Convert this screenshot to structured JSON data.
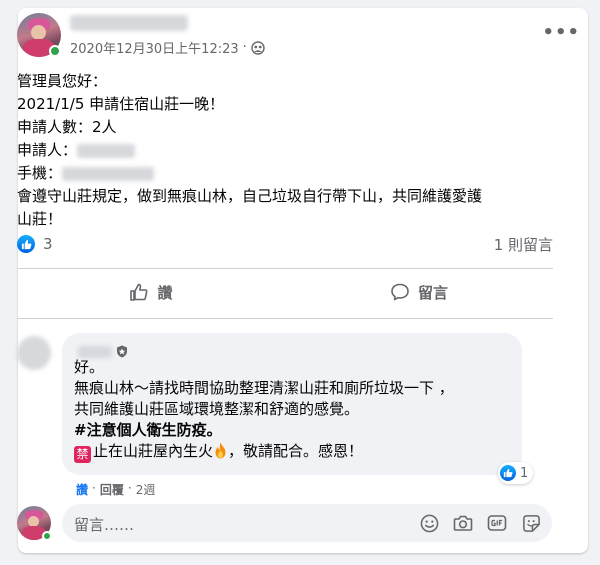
{
  "post": {
    "timestamp": "2020年12月30日上午12:23",
    "separator": "·",
    "more_label": "•••",
    "body": {
      "greeting": "管理員您好：",
      "request": "2021/1/5 申請住宿山莊一晚！",
      "headcount": "申請人數：2人",
      "applicant_label": "申請人：",
      "phone_label": "手機：",
      "pledge_1": "會遵守山莊規定，做到無痕山林，自己垃圾自行帶下山，共同維護愛護",
      "pledge_2": "山莊！"
    }
  },
  "stats": {
    "like_count": "3",
    "comment_count": "1 則留言"
  },
  "actions": {
    "like_label": "讚",
    "comment_label": "留言"
  },
  "comment": {
    "line1": "好。",
    "line2": "無痕山林～請找時間協助整理清潔山莊和廁所垃圾一下 ，",
    "line3": "共同維護山莊區域環境整潔和舒適的感覺。",
    "line4": "#注意個人衛生防疫。",
    "ban_glyph": "禁",
    "line5_text": "止在山莊屋內生火",
    "line5_tail": "，敬請配合。感恩！",
    "like_count": "1",
    "like_action": "讚",
    "dot": "·",
    "reply_action": "回覆",
    "age": "2週"
  },
  "composer": {
    "placeholder": "留言……"
  },
  "colors": {
    "brand": "#1877f2",
    "secondary_text": "#65676b",
    "online": "#31a24c"
  }
}
